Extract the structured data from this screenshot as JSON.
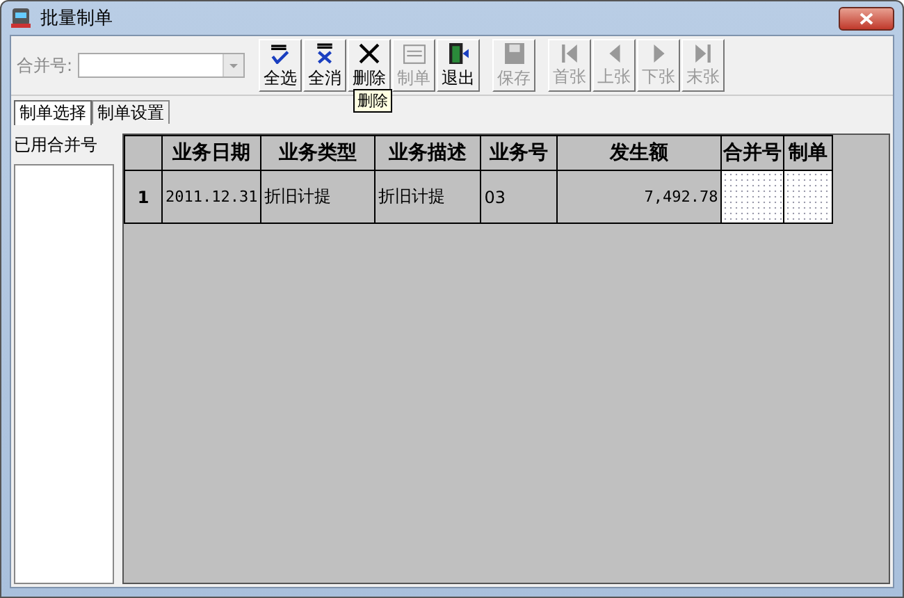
{
  "window": {
    "title": "批量制单"
  },
  "merge_field": {
    "label": "合并号:"
  },
  "toolbar": [
    {
      "label": "全选",
      "kind": "select-all",
      "disabled": false
    },
    {
      "label": "全消",
      "kind": "deselect-all",
      "disabled": false
    },
    {
      "label": "删除",
      "kind": "delete",
      "disabled": false
    },
    {
      "label": "制单",
      "kind": "voucher",
      "disabled": true
    },
    {
      "label": "退出",
      "kind": "exit",
      "disabled": false
    },
    {
      "label": "保存",
      "kind": "save",
      "disabled": true
    },
    {
      "label": "首张",
      "kind": "first",
      "disabled": true
    },
    {
      "label": "上张",
      "kind": "prev",
      "disabled": true
    },
    {
      "label": "下张",
      "kind": "next",
      "disabled": true
    },
    {
      "label": "末张",
      "kind": "last",
      "disabled": true
    }
  ],
  "tooltip": "删除",
  "tabs": [
    {
      "label": "制单选择",
      "selected": true
    },
    {
      "label": "制单设置",
      "selected": false
    }
  ],
  "sidebar": {
    "label": "已用合并号"
  },
  "table": {
    "columns": [
      "业务日期",
      "业务类型",
      "业务描述",
      "业务号",
      "发生额",
      "合并号",
      "制单"
    ],
    "rows": [
      {
        "index": "1",
        "cells": [
          "2011.12.31",
          "折旧计提",
          "折旧计提",
          "03",
          "7,492.78"
        ]
      }
    ]
  }
}
